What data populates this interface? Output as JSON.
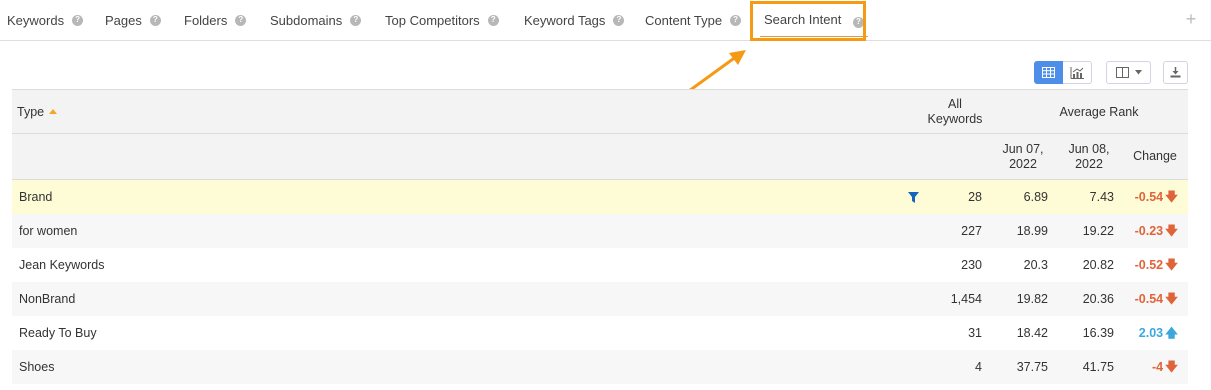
{
  "tabs": [
    {
      "label": "Keywords"
    },
    {
      "label": "Pages"
    },
    {
      "label": "Folders"
    },
    {
      "label": "Subdomains"
    },
    {
      "label": "Top Competitors"
    },
    {
      "label": "Keyword Tags"
    },
    {
      "label": "Content Type"
    },
    {
      "label": "Search Intent"
    }
  ],
  "active_tab": "Search Intent",
  "help_glyph": "?",
  "add_glyph": "+",
  "colors": {
    "accent": "#f59a14",
    "negative": "#e0643a",
    "positive": "#3aa8dc",
    "highlight_row": "#fefcd6",
    "button_active": "#4d8fe8",
    "filter": "#1565c0"
  },
  "toolbar": {
    "icons": [
      "table-view-icon",
      "chart-view-icon",
      "columns-icon",
      "download-icon"
    ],
    "active_view": "table"
  },
  "table": {
    "header": {
      "type_label": "Type",
      "all_keywords_line1": "All",
      "all_keywords_line2": "Keywords",
      "average_rank": "Average Rank",
      "date1_line1": "Jun 07,",
      "date1_line2": "2022",
      "date2_line1": "Jun 08,",
      "date2_line2": "2022",
      "change": "Change"
    },
    "rows": [
      {
        "type": "Brand",
        "all": "28",
        "r1": "6.89",
        "r2": "7.43",
        "change": "-0.54",
        "dir": "down",
        "filtered": true
      },
      {
        "type": "for women",
        "all": "227",
        "r1": "18.99",
        "r2": "19.22",
        "change": "-0.23",
        "dir": "down"
      },
      {
        "type": "Jean Keywords",
        "all": "230",
        "r1": "20.3",
        "r2": "20.82",
        "change": "-0.52",
        "dir": "down"
      },
      {
        "type": "NonBrand",
        "all": "1,454",
        "r1": "19.82",
        "r2": "20.36",
        "change": "-0.54",
        "dir": "down"
      },
      {
        "type": "Ready To Buy",
        "all": "31",
        "r1": "18.42",
        "r2": "16.39",
        "change": "2.03",
        "dir": "up"
      },
      {
        "type": "Shoes",
        "all": "4",
        "r1": "37.75",
        "r2": "41.75",
        "change": "-4",
        "dir": "down"
      }
    ]
  }
}
